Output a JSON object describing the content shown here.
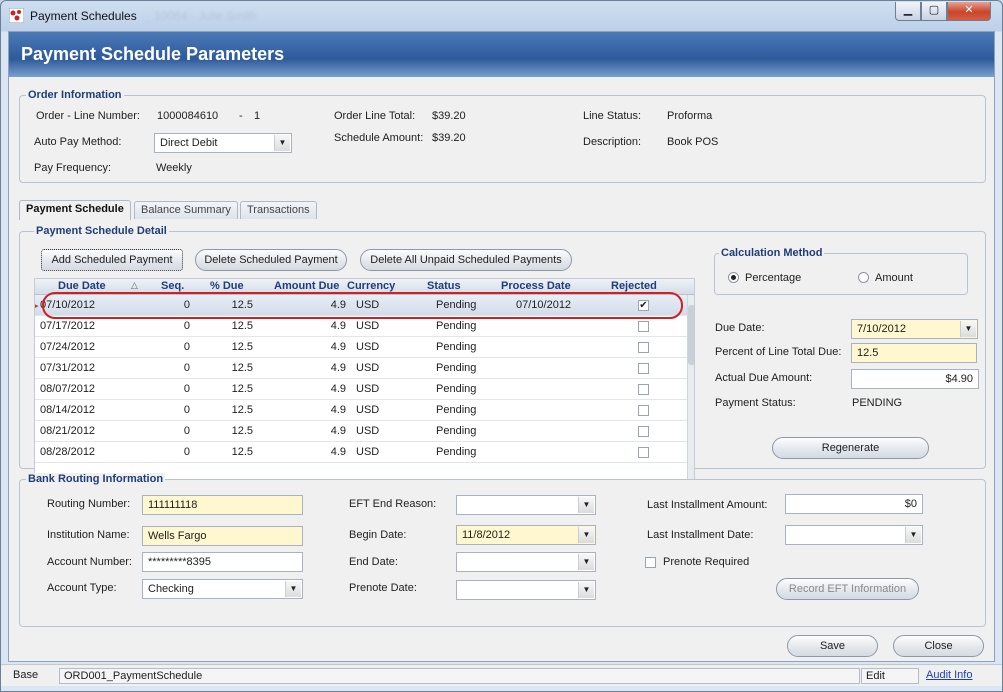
{
  "window": {
    "title": "Payment Schedules",
    "blurred_title": "_ 10064 - Julie Smith"
  },
  "banner": {
    "title": "Payment Schedule Parameters"
  },
  "order_info": {
    "group_title": "Order Information",
    "order_line_label": "Order - Line Number:",
    "order_number": "1000084610",
    "order_dash": "-",
    "line_number": "1",
    "auto_pay_label": "Auto Pay Method:",
    "auto_pay_value": "Direct Debit",
    "pay_freq_label": "Pay Frequency:",
    "pay_freq_value": "Weekly",
    "order_line_total_label": "Order Line Total:",
    "order_line_total_value": "$39.20",
    "schedule_amount_label": "Schedule Amount:",
    "schedule_amount_value": "$39.20",
    "line_status_label": "Line Status:",
    "line_status_value": "Proforma",
    "description_label": "Description:",
    "description_value": "Book POS"
  },
  "tabs": [
    "Payment Schedule",
    "Balance Summary",
    "Transactions"
  ],
  "schedule_detail": {
    "group_title": "Payment Schedule Detail",
    "add_btn": "Add Scheduled Payment",
    "delete_btn": "Delete Scheduled Payment",
    "delete_all_btn": "Delete All Unpaid Scheduled Payments",
    "columns": [
      "Due Date",
      "Seq.",
      "% Due",
      "Amount Due",
      "Currency",
      "Status",
      "Process Date",
      "Rejected"
    ],
    "rows": [
      {
        "due": "07/10/2012",
        "seq": "0",
        "pct": "12.5",
        "amt": "4.9",
        "cur": "USD",
        "status": "Pending",
        "process": "07/10/2012",
        "rejected": true
      },
      {
        "due": "07/17/2012",
        "seq": "0",
        "pct": "12.5",
        "amt": "4.9",
        "cur": "USD",
        "status": "Pending",
        "process": "",
        "rejected": false
      },
      {
        "due": "07/24/2012",
        "seq": "0",
        "pct": "12.5",
        "amt": "4.9",
        "cur": "USD",
        "status": "Pending",
        "process": "",
        "rejected": false
      },
      {
        "due": "07/31/2012",
        "seq": "0",
        "pct": "12.5",
        "amt": "4.9",
        "cur": "USD",
        "status": "Pending",
        "process": "",
        "rejected": false
      },
      {
        "due": "08/07/2012",
        "seq": "0",
        "pct": "12.5",
        "amt": "4.9",
        "cur": "USD",
        "status": "Pending",
        "process": "",
        "rejected": false
      },
      {
        "due": "08/14/2012",
        "seq": "0",
        "pct": "12.5",
        "amt": "4.9",
        "cur": "USD",
        "status": "Pending",
        "process": "",
        "rejected": false
      },
      {
        "due": "08/21/2012",
        "seq": "0",
        "pct": "12.5",
        "amt": "4.9",
        "cur": "USD",
        "status": "Pending",
        "process": "",
        "rejected": false
      },
      {
        "due": "08/28/2012",
        "seq": "0",
        "pct": "12.5",
        "amt": "4.9",
        "cur": "USD",
        "status": "Pending",
        "process": "",
        "rejected": false
      }
    ]
  },
  "calc_method": {
    "group_title": "Calculation Method",
    "percentage_label": "Percentage",
    "amount_label": "Amount",
    "selected": "Percentage"
  },
  "detail_fields": {
    "due_date_label": "Due Date:",
    "due_date_value": "7/10/2012",
    "percent_label": "Percent of Line Total Due:",
    "percent_value": "12.5",
    "actual_due_label": "Actual Due Amount:",
    "actual_due_value": "$4.90",
    "payment_status_label": "Payment Status:",
    "payment_status_value": "PENDING",
    "regenerate_btn": "Regenerate"
  },
  "bank": {
    "group_title": "Bank Routing Information",
    "routing_label": "Routing Number:",
    "routing_value": "111111118",
    "institution_label": "Institution Name:",
    "institution_value": "Wells Fargo",
    "account_number_label": "Account Number:",
    "account_number_value": "*********8395",
    "account_type_label": "Account Type:",
    "account_type_value": "Checking",
    "eft_end_reason_label": "EFT End Reason:",
    "eft_end_reason_value": "",
    "begin_date_label": "Begin Date:",
    "begin_date_value": "11/8/2012",
    "end_date_label": "End Date:",
    "end_date_value": "",
    "prenote_date_label": "Prenote Date:",
    "prenote_date_value": "",
    "last_inst_amount_label": "Last Installment Amount:",
    "last_inst_amount_value": "$0",
    "last_inst_date_label": "Last Installment Date:",
    "last_inst_date_value": "",
    "prenote_required_label": "Prenote Required",
    "record_eft_btn": "Record EFT Information"
  },
  "footer": {
    "save_btn": "Save",
    "close_btn": "Close"
  },
  "statusbar": {
    "base": "Base",
    "form": "ORD001_PaymentSchedule",
    "mode": "Edit",
    "audit": "Audit Info"
  }
}
